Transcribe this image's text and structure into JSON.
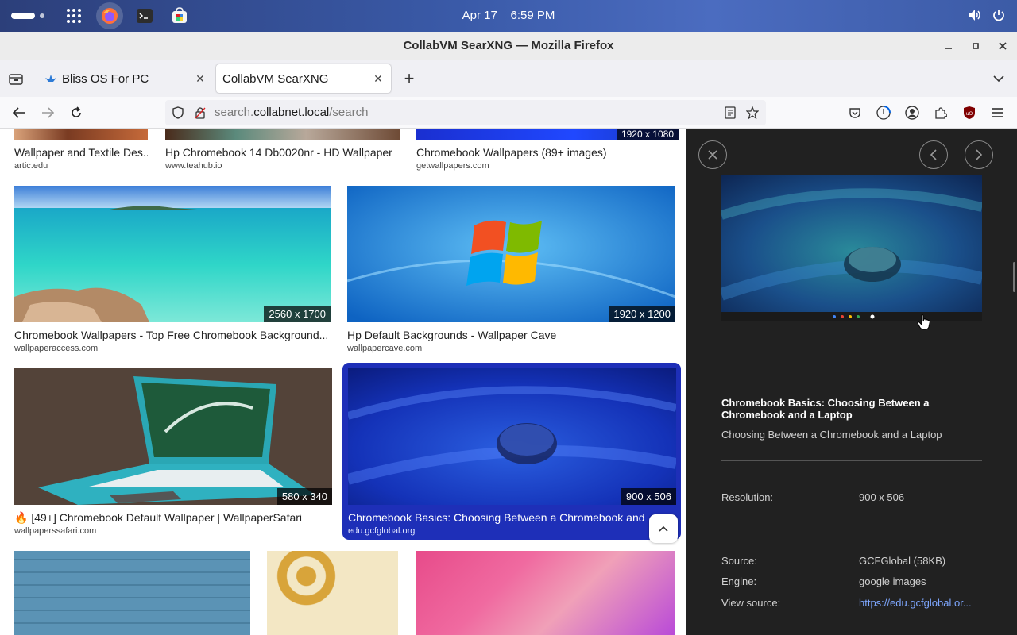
{
  "topbar": {
    "date": "Apr 17",
    "time": "6:59 PM"
  },
  "window": {
    "title": "CollabVM SearXNG — Mozilla Firefox"
  },
  "tabs": [
    {
      "label": "Bliss OS For PC"
    },
    {
      "label": "CollabVM SearXNG"
    }
  ],
  "urlbar": {
    "prefix": "search.",
    "domain": "collabnet.local",
    "path": "/search"
  },
  "results": [
    {
      "title": "Wallpaper and Textile Des...",
      "source": "artic.edu"
    },
    {
      "title": "Hp Chromebook 14 Db0020nr - HD Wallpaper",
      "source": "www.teahub.io"
    },
    {
      "title": "Chromebook Wallpapers (89+ images)",
      "source": "getwallpapers.com",
      "resolution": "1920 x 1080"
    },
    {
      "title": "Chromebook Wallpapers - Top Free Chromebook Background...",
      "source": "wallpaperaccess.com",
      "resolution": "2560 x 1700"
    },
    {
      "title": "Hp Default Backgrounds - Wallpaper Cave",
      "source": "wallpapercave.com",
      "resolution": "1920 x 1200"
    },
    {
      "title": "🔥 [49+] Chromebook Default Wallpaper | WallpaperSafari",
      "source": "wallpaperssafari.com",
      "resolution": "580 x 340"
    },
    {
      "title": "Chromebook Basics: Choosing Between a Chromebook and a Laptop",
      "source": "edu.gcfglobal.org",
      "resolution": "900 x 506"
    }
  ],
  "detail": {
    "title": "Chromebook Basics: Choosing Between a Chromebook and a Laptop",
    "subtitle": "Choosing Between a Chromebook and a Laptop",
    "resolution_label": "Resolution:",
    "resolution_value": "900 x 506",
    "source_label": "Source:",
    "source_value": "GCFGlobal (58KB)",
    "engine_label": "Engine:",
    "engine_value": "google images",
    "view_source_label": "View source:",
    "view_source_value": "https://edu.gcfglobal.or..."
  }
}
